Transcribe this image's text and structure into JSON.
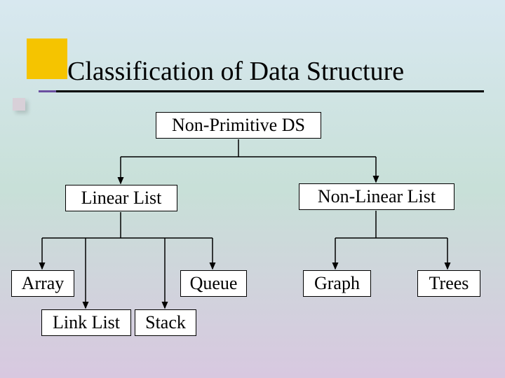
{
  "title": "Classification of Data Structure",
  "diagram": {
    "root": "Non-Primitive DS",
    "children": [
      {
        "label": "Linear List",
        "children": [
          "Array",
          "Link List",
          "Stack",
          "Queue"
        ]
      },
      {
        "label": "Non-Linear List",
        "children": [
          "Graph",
          "Trees"
        ]
      }
    ]
  }
}
